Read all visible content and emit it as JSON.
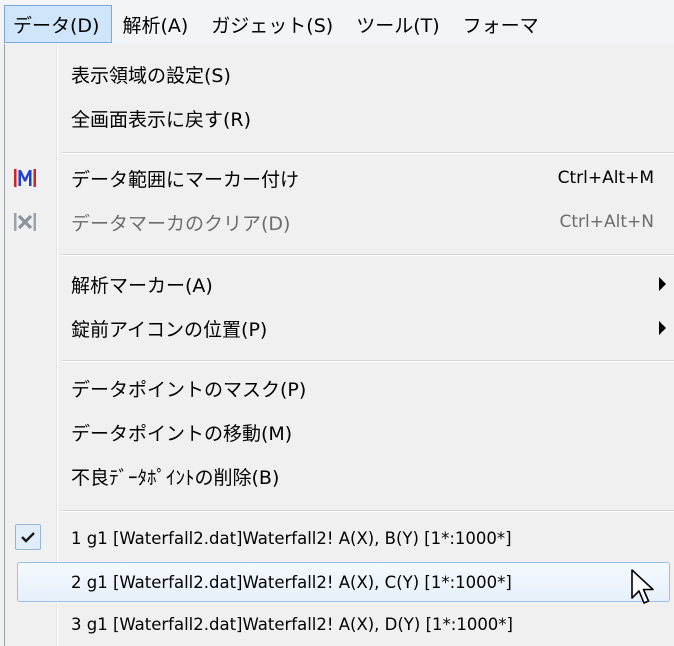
{
  "menubar": {
    "items": [
      "データ(D)",
      "解析(A)",
      "ガジェット(S)",
      "ツール(T)",
      "フォーマ"
    ]
  },
  "menu": {
    "items": [
      {
        "label": "表示領域の設定(S)"
      },
      {
        "label": "全画面表示に戻す(R)"
      },
      {
        "label": "データ範囲にマーカー付け",
        "shortcut": "Ctrl+Alt+M",
        "icon": "mark-range-icon"
      },
      {
        "label": "データマーカのクリア(D)",
        "shortcut": "Ctrl+Alt+N",
        "icon": "clear-markers-icon",
        "disabled": true
      },
      {
        "label": "解析マーカー(A)",
        "submenu": true
      },
      {
        "label": "錠前アイコンの位置(P)",
        "submenu": true
      },
      {
        "label": "データポイントのマスク(P)"
      },
      {
        "label": "データポイントの移動(M)"
      },
      {
        "label": "不良ﾃﾞｰﾀﾎﾟｲﾝﾄの削除(B)"
      },
      {
        "label": "1 g1 [Waterfall2.dat]Waterfall2! A(X), B(Y) [1*:1000*]",
        "checked": true
      },
      {
        "label": "2 g1 [Waterfall2.dat]Waterfall2! A(X), C(Y) [1*:1000*]",
        "highlighted": true
      },
      {
        "label": "3 g1 [Waterfall2.dat]Waterfall2! A(X), D(Y) [1*:1000*]"
      }
    ]
  },
  "colors": {
    "menubar_active_bg": "#cfe5fa",
    "highlight_border": "#9cbfe6",
    "marker_blue": "#2040d0",
    "marker_red": "#d0202a"
  }
}
